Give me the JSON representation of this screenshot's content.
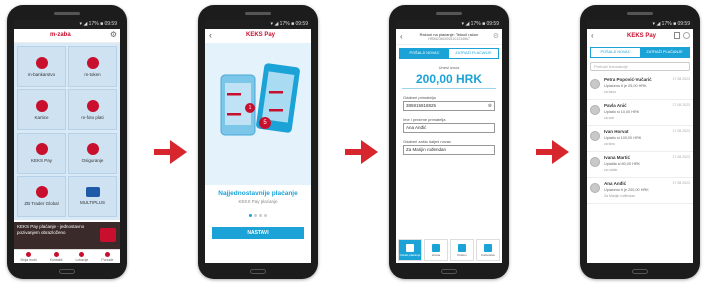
{
  "phone1": {
    "logo": "m-zaba",
    "tiles": [
      {
        "label": "m-bankarstvo",
        "icon": "bank-icon"
      },
      {
        "label": "m-token",
        "icon": "token-icon"
      },
      {
        "label": "Kartice",
        "icon": "card-icon"
      },
      {
        "label": "m-foto plati",
        "icon": "camera-icon"
      },
      {
        "label": "KEKS Pay",
        "icon": "keks-icon"
      },
      {
        "label": "Osiguranje",
        "icon": "umbrella-icon"
      },
      {
        "label": "ZB Trader Global",
        "icon": "trader-icon"
      },
      {
        "label": "MULTIPLUS",
        "icon": "multiplus-icon"
      }
    ],
    "banner_text": "KEKS Pay plaćanje - jednostavno pozivanjem obrazloženo",
    "nav": [
      "Moja mobi",
      "Kontakti",
      "Lokacije",
      "Ponude"
    ]
  },
  "phone2": {
    "logo": "KEKS Pay",
    "title": "Najjednostavnije plaćanje",
    "subtitle": "KEKS Pay plaćanje",
    "badge1": "1",
    "badge2": "5",
    "button_label": "NASTAVI"
  },
  "phone3": {
    "header_line1": "Računi na plaćanje: Tekući račun",
    "header_line2": "HR5623600001101234567",
    "tab_send": "POŠALJI NOVAC",
    "tab_request": "ZATRAŽI PLAĆANJE",
    "amount_label": "Unesi iznos",
    "amount": "200,00 HRK",
    "recipient_label": "Odaberi primatelja",
    "recipient_value": "385915818825",
    "name_label": "Ime i prezime primatelja",
    "name_value": "Ana Anđić",
    "reason_label": "Odaberi zašto šalješ novac",
    "reason_value": "Za Marijin rođendan",
    "icons": [
      "Ostalo plaćanje",
      "Hrana",
      "Poklon",
      "Kućanstvo"
    ]
  },
  "phone4": {
    "logo": "KEKS Pay",
    "tab_send": "POŠALJI NOVAC",
    "tab_request": "ZATRAŽI PLAĆANJE",
    "search_placeholder": "Pretraži transakcije",
    "transactions": [
      {
        "name": "Petra Popović-Vučarić",
        "desc": "Uplaćeno ti je 25,00 HRK",
        "note": "za kavu",
        "date": "17.08.2023"
      },
      {
        "name": "Pavla Anić",
        "desc": "Uplatio si 10,00 HRK",
        "note": "za sok",
        "date": "17.08.2023"
      },
      {
        "name": "Ivan Horvat",
        "desc": "Uplatio si 100,00 HRK",
        "note": "za kino",
        "date": "17.08.2023"
      },
      {
        "name": "Ivana Martić",
        "desc": "Uplatila si 80,00 HRK",
        "note": "za ručak",
        "date": "17.08.2023"
      },
      {
        "name": "Ana Anđić",
        "desc": "Uplaćeno ti je 200,00 HRK",
        "note": "Za Marijin rođendan",
        "date": "17.08.2023"
      }
    ]
  },
  "colors": {
    "accent": "#1ba3d8",
    "brand_red": "#c8102e",
    "arrow": "#d7262e"
  }
}
